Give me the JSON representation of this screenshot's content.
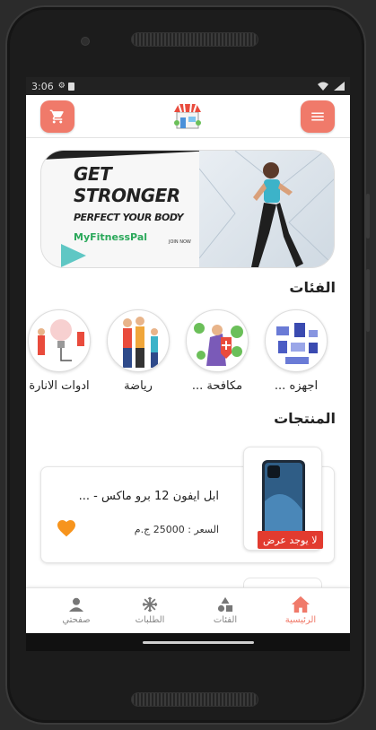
{
  "status": {
    "time": "3:06"
  },
  "appbar": {
    "cart_icon": "cart-icon",
    "menu_icon": "menu-icon",
    "logo_icon": "store-logo"
  },
  "banner": {
    "line1": "GET",
    "line2": "STRONGER",
    "line3": "PERFECT YOUR BODY",
    "brand": "MyFitnessPal",
    "cta": "JOIN NOW"
  },
  "categories": {
    "title": "الفئات",
    "items": [
      {
        "label": "اجهزه ..."
      },
      {
        "label": "مكافحة ..."
      },
      {
        "label": "رياضة"
      },
      {
        "label": "ادوات الانارة"
      }
    ]
  },
  "products": {
    "title": "المنتجات",
    "items": [
      {
        "name": "ابل ايفون 12 برو ماكس - ...",
        "price": "السعر : 25000 ج.م",
        "badge": "لا يوجد عرض"
      }
    ]
  },
  "bottom_nav": {
    "items": [
      {
        "label": "الرئيسية",
        "icon": "home-icon",
        "active": true
      },
      {
        "label": "الفئات",
        "icon": "categories-icon",
        "active": false
      },
      {
        "label": "الطلبات",
        "icon": "orders-icon",
        "active": false
      },
      {
        "label": "صفحتي",
        "icon": "profile-icon",
        "active": false
      }
    ]
  },
  "colors": {
    "accent": "#f07a6a",
    "badge": "#e23b2f",
    "heart": "#f7941d"
  }
}
